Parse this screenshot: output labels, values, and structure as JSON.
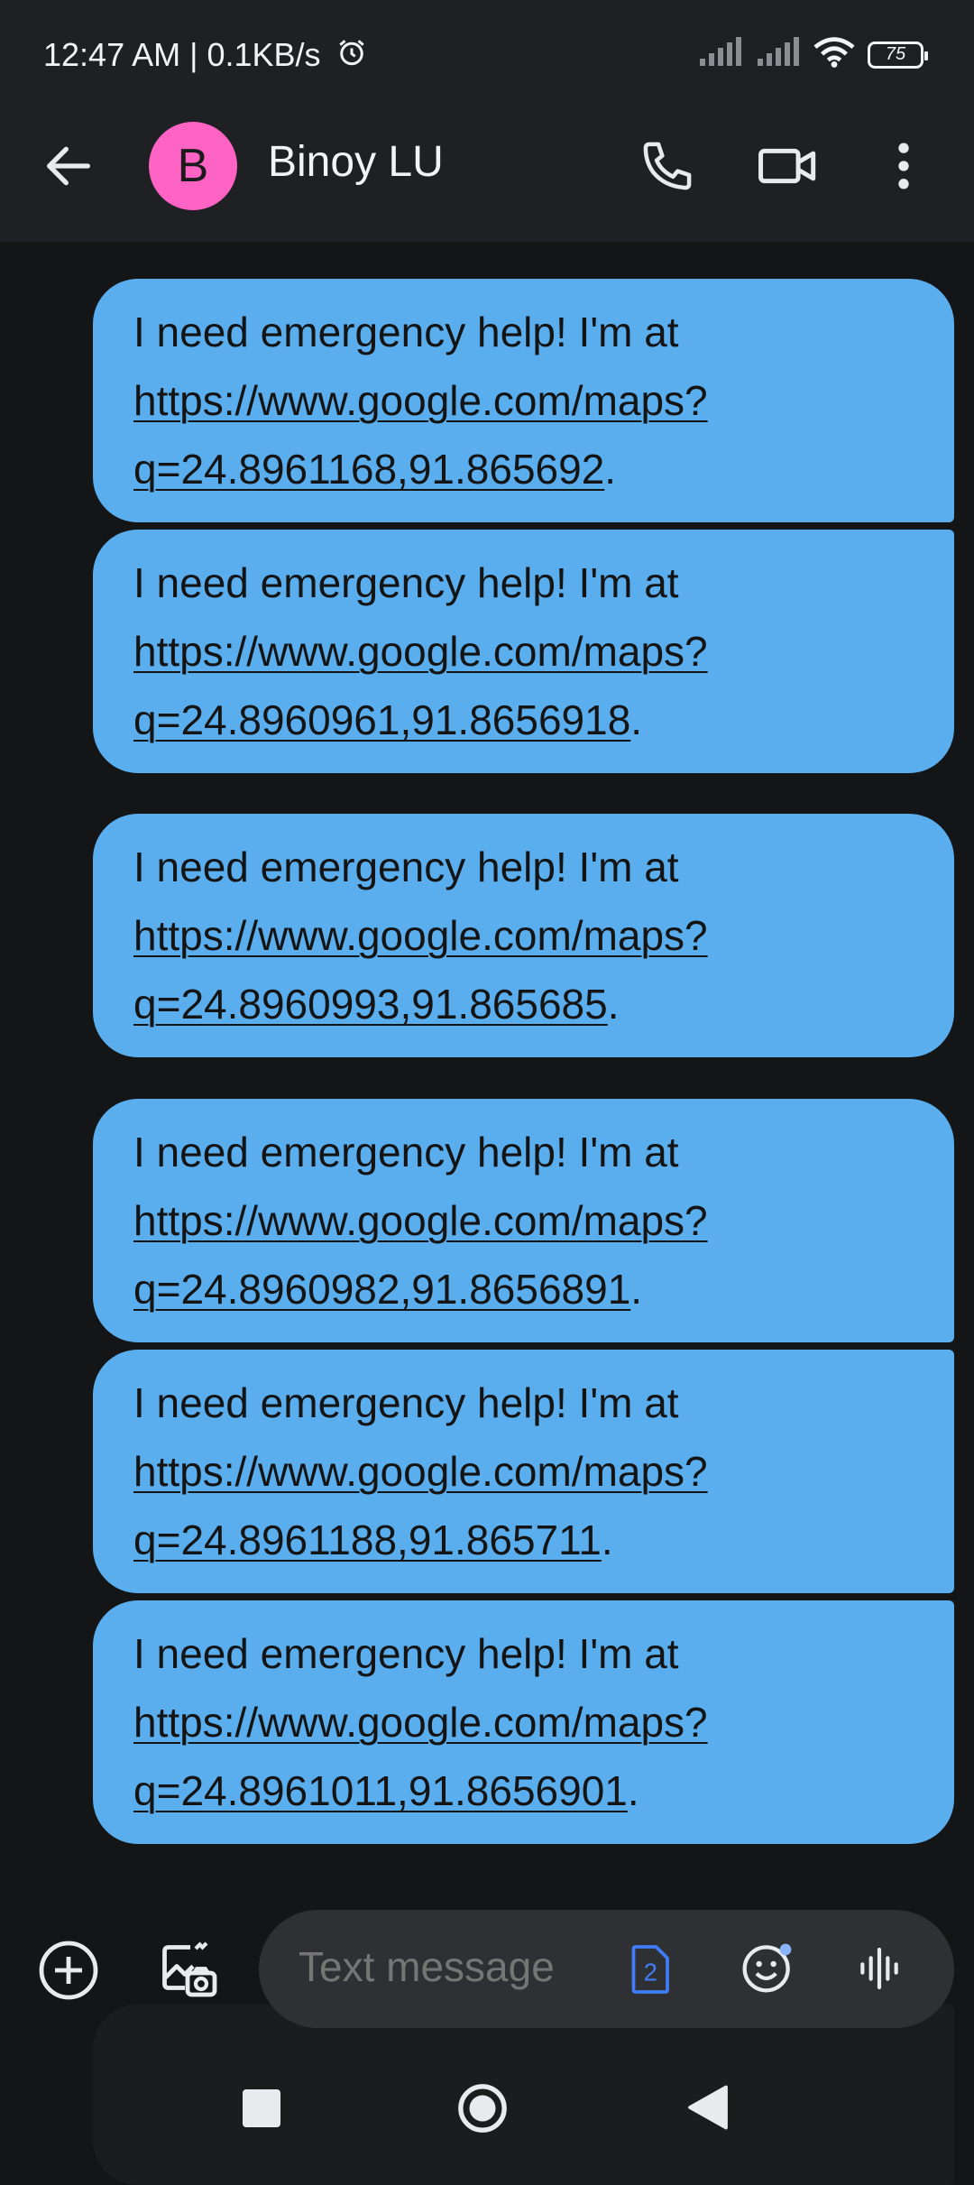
{
  "status_bar": {
    "time": "12:47 AM | 0.1KB/s",
    "battery": "75",
    "icons": [
      "alarm-icon",
      "signal-icon",
      "signal-icon",
      "wifi-icon",
      "battery-icon"
    ]
  },
  "header": {
    "avatar_letter": "B",
    "avatar_color": "#ff63c4",
    "contact_name": "Binoy LU",
    "actions": [
      "back-arrow-icon",
      "phone-icon",
      "video-call-icon",
      "more-vert-icon"
    ]
  },
  "messages": [
    {
      "text": "I need emergency help! I'm at",
      "link": "https://www.google.com/maps?q=24.8961168,91.865692",
      "trail": "."
    },
    {
      "text": "I need emergency help! I'm at",
      "link": "https://www.google.com/maps?q=24.8960961,91.8656918",
      "trail": "."
    },
    {
      "text": "I need emergency help! I'm at",
      "link": "https://www.google.com/maps?q=24.8960993,91.865685",
      "trail": "."
    },
    {
      "text": "I need emergency help! I'm at",
      "link": "https://www.google.com/maps?q=24.8960982,91.8656891",
      "trail": "."
    },
    {
      "text": "I need emergency help! I'm at",
      "link": "https://www.google.com/maps?q=24.8961188,91.865711",
      "trail": "."
    },
    {
      "text": "I need emergency help! I'm at",
      "link": "https://www.google.com/maps?q=24.8961011,91.8656901",
      "trail": "."
    }
  ],
  "composer": {
    "placeholder": "Text message",
    "sim": "2",
    "icons": [
      "add-circle-icon",
      "gallery-icon",
      "sim-icon",
      "emoji-icon",
      "voice-icon"
    ]
  },
  "colors": {
    "bubble": "#5aaeee",
    "background": "#141517",
    "bar": "#1f2023",
    "avatar": "#ff63c4",
    "sim_accent": "#3f7cf5"
  }
}
